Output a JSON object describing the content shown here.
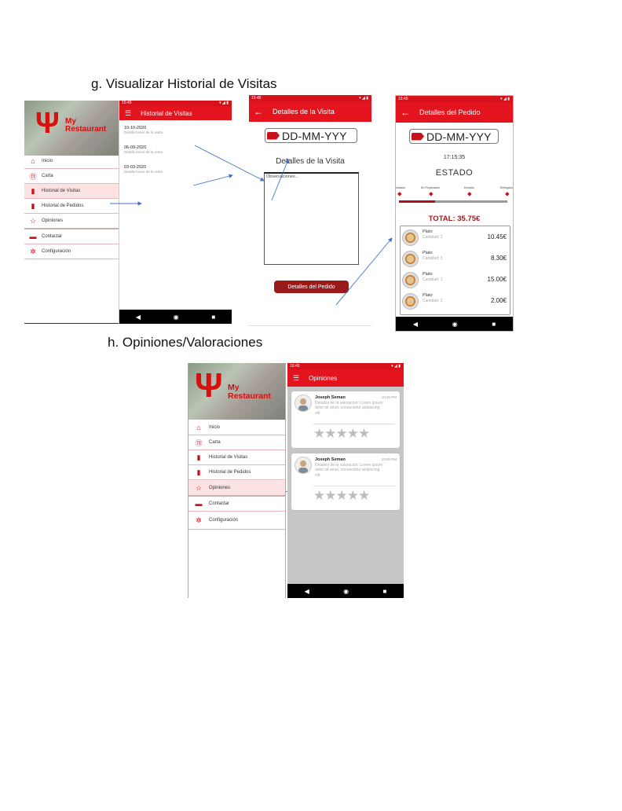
{
  "sections": {
    "g_title": "g.  Visualizar Historial de Visitas",
    "h_title": "h.  Opiniones/Valoraciones"
  },
  "drawer": {
    "brand_line1": "My",
    "brand_line2": "Restaurant",
    "items": [
      {
        "label": "Inicio",
        "icon": "home-icon"
      },
      {
        "label": "Carta",
        "icon": "restaurant-icon"
      },
      {
        "label": "Historial de Visitas",
        "icon": "book-icon"
      },
      {
        "label": "Historial de Pedidos",
        "icon": "bookmark-icon"
      },
      {
        "label": "Opiniones",
        "icon": "star-icon"
      },
      {
        "label": "Contactar",
        "icon": "chat-icon"
      },
      {
        "label": "Configuración",
        "icon": "gear-icon"
      }
    ]
  },
  "status": {
    "time": "15:45",
    "icons": "▾ ◢ ▮"
  },
  "history_screen": {
    "title": "Historial de Visitas",
    "visits": [
      {
        "date": "10-10-2020",
        "desc": "Detalle breve de la visita"
      },
      {
        "date": "06-09-2020",
        "desc": "Detalle breve de la visita"
      },
      {
        "date": "03-03-2020",
        "desc": "Detalle breve de la visita"
      }
    ]
  },
  "visit_detail": {
    "title": "Detalles de la Visita",
    "date": "DD-MM-YYY",
    "section_title": "Detalles de la Visita",
    "obs_placeholder": "Observaciones...",
    "button": "Detalles del Pedido"
  },
  "order_detail": {
    "title": "Detalles del Pedido",
    "date": "DD-MM-YYY",
    "time": "17:15:35",
    "estado": "ESTADO",
    "steps": [
      "Iniciado",
      "En Preparación",
      "Enviado",
      "Entregado"
    ],
    "progress": 0.33,
    "total": "TOTAL: 35.75€",
    "items": [
      {
        "name": "Plato",
        "qty": "Cantidad: 2",
        "price": "10.45€"
      },
      {
        "name": "Plato",
        "qty": "Cantidad: 3",
        "price": "8.30€"
      },
      {
        "name": "Plato",
        "qty": "Cantidad: 1",
        "price": "15.00€"
      },
      {
        "name": "Plato",
        "qty": "Cantidad: 2",
        "price": "2.00€"
      }
    ]
  },
  "opinions_screen": {
    "title": "Opiniones",
    "reviews": [
      {
        "name": "Joseph Seman",
        "time": "10:45 PM",
        "desc": "Detalles de la valoracion: Lorem ipsum dolor sit amet, consectetur adipiscing elit.",
        "stars": 0
      },
      {
        "name": "Joseph Seman",
        "time": "10:45 PM",
        "desc": "Detalles de la valoracion: Lorem ipsum dolor sit amet, consectetur adipiscing elit.",
        "stars": 0
      }
    ]
  },
  "nav": {
    "back": "◀",
    "home": "◉",
    "recent": "■"
  },
  "colors": {
    "accent": "#e3141e",
    "dark_accent": "#9a1a1a",
    "total": "#a81818"
  }
}
